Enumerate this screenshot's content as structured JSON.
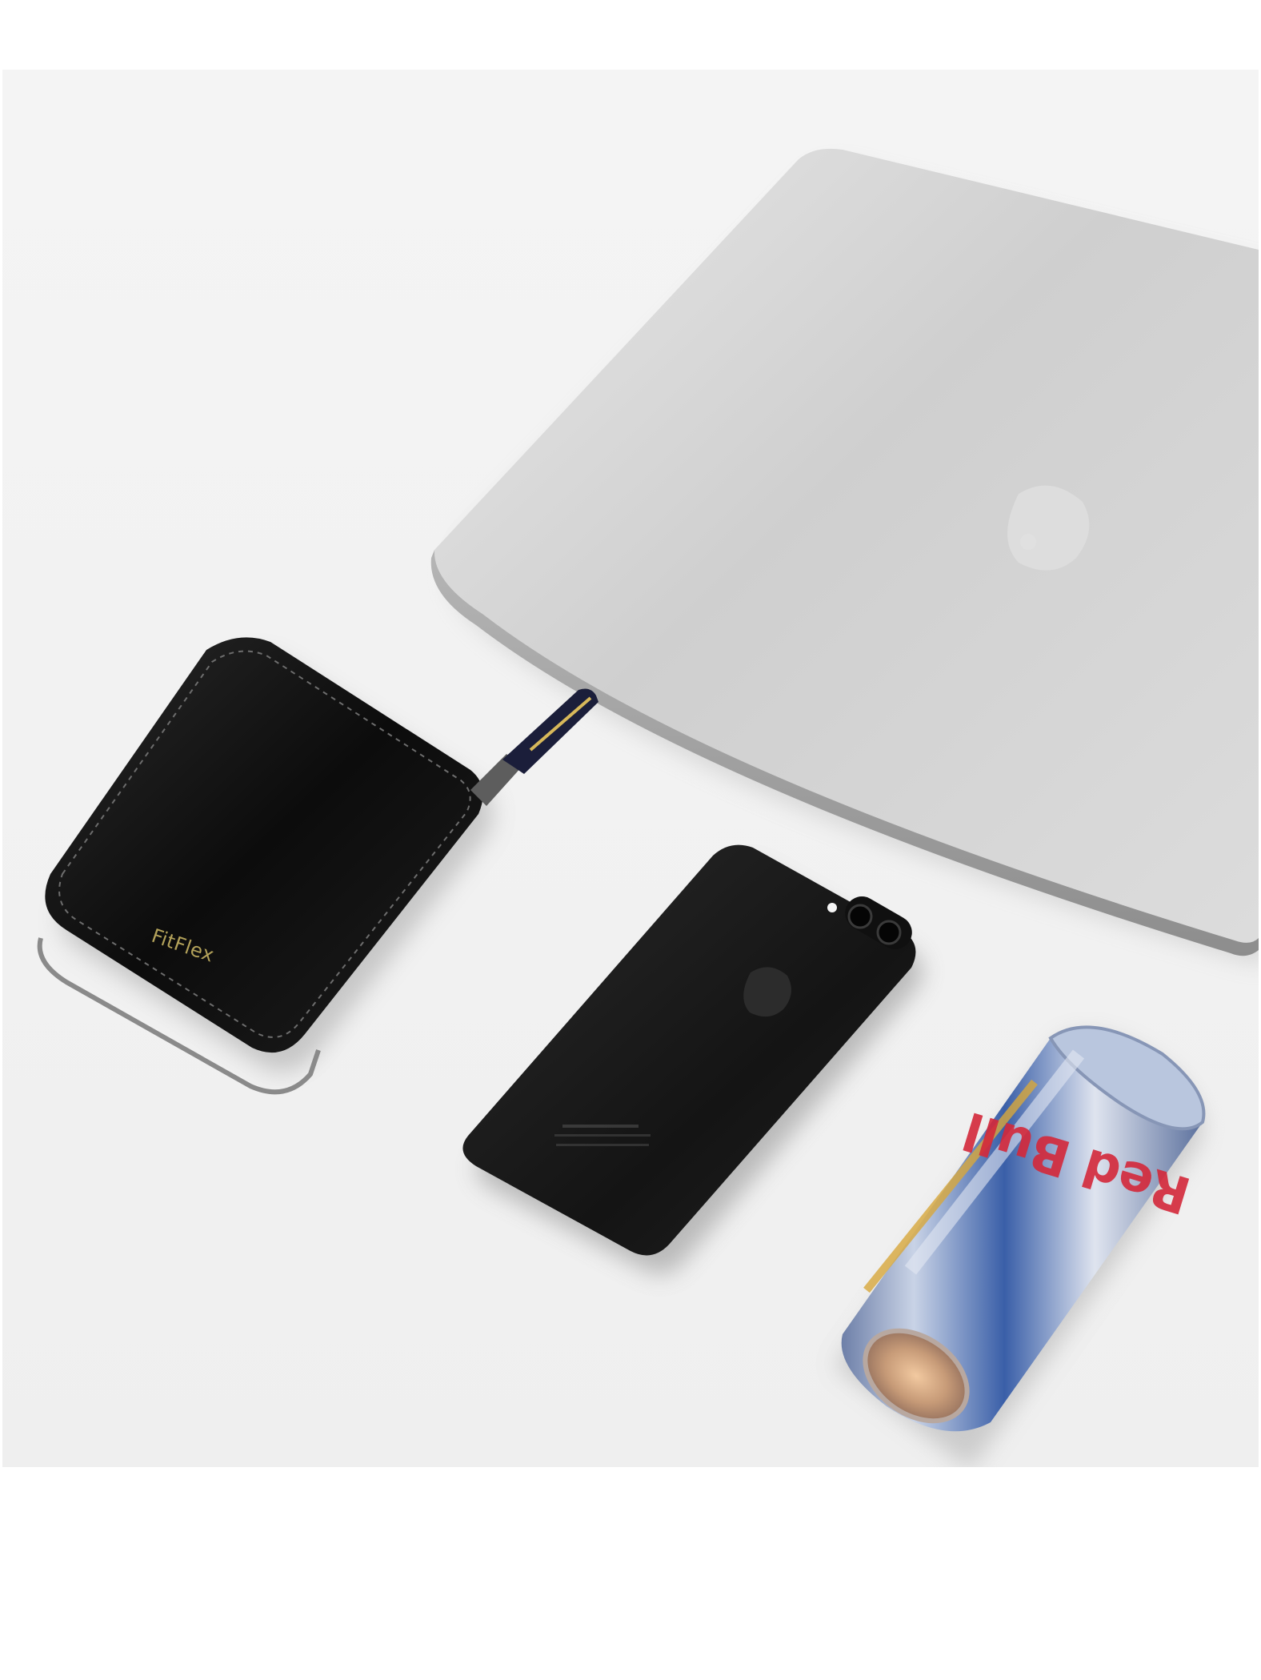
{
  "photo": {
    "subject_items": [
      "laptop",
      "wallet",
      "smartphone",
      "drink-can"
    ]
  },
  "wallet": {
    "brand": "FitFlex"
  },
  "can": {
    "logo_text": "Red Bull"
  },
  "colors": {
    "background": "#f2f2f2",
    "laptop_silver": "#c9c9c9",
    "wallet_black": "#0f0f0f",
    "phone_black": "#1a1a1a",
    "brand_gold": "#b3a25a",
    "can_blue": "#3a5fa8",
    "can_red": "#d4283a"
  }
}
